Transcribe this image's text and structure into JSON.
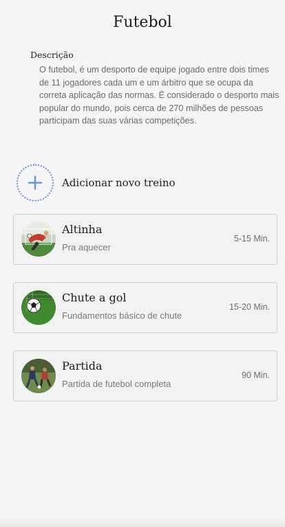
{
  "header": {
    "title": "Futebol"
  },
  "description": {
    "heading": "Descrição",
    "text": "O futebol, é um desporto de equipe jogado entre dois times de 11 jogadores cada um e um árbitro que se ocupa da correta aplicação das normas. É considerado o desporto mais popular do mundo, pois cerca de 270 milhões de pessoas participam das suas várias competições."
  },
  "add_training": {
    "icon": "plus-icon",
    "label": "Adicionar novo treino",
    "accent_color": "#6b8fd8"
  },
  "trainings": [
    {
      "title": "Altinha",
      "subtitle": "Pra aquecer",
      "duration": "5-15 Min.",
      "image": "goalkeeper-photo"
    },
    {
      "title": "Chute a gol",
      "subtitle": "Fundamentos básico de chute",
      "duration": "15-20 Min.",
      "image": "soccer-ball-goal-photo"
    },
    {
      "title": "Partida",
      "subtitle": "Partida de futebol completa",
      "duration": "90 Min.",
      "image": "match-players-photo"
    }
  ]
}
